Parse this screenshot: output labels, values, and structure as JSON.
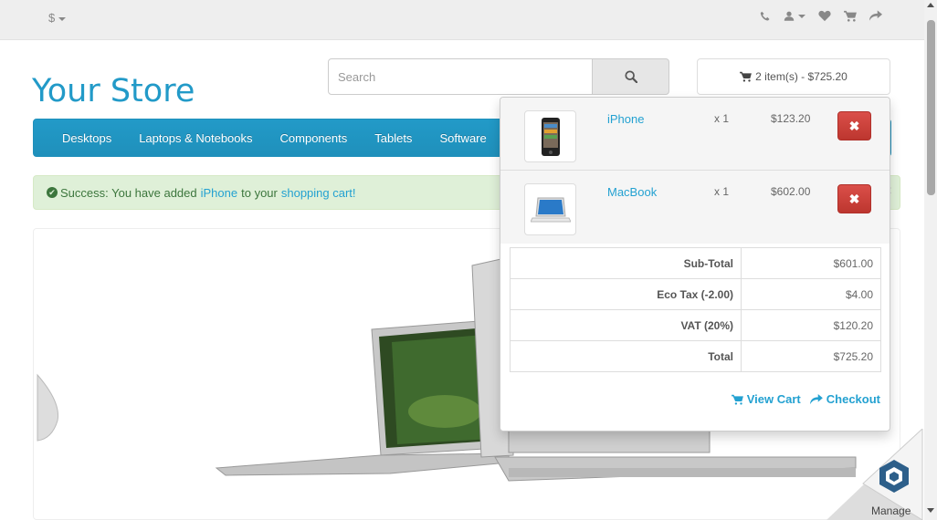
{
  "topbar": {
    "currency_symbol": "$",
    "icons": [
      "phone-icon",
      "user-icon",
      "heart-icon",
      "cart-icon",
      "share-icon"
    ]
  },
  "logo": {
    "text": "Your Store",
    "color": "#229ac8"
  },
  "search": {
    "placeholder": "Search"
  },
  "cart_button": {
    "label": "2 item(s) - $725.20"
  },
  "menu": {
    "items": [
      "Desktops",
      "Laptops & Notebooks",
      "Components",
      "Tablets",
      "Software"
    ]
  },
  "alert": {
    "prefix": "Success: You have added",
    "product_link": "iPhone",
    "middle": "to your",
    "cart_link": "shopping cart!",
    "close": "×"
  },
  "cart_dropdown": {
    "items": [
      {
        "name": "iPhone",
        "qty": "x 1",
        "price": "$123.20",
        "remove": "✖"
      },
      {
        "name": "MacBook",
        "qty": "x 1",
        "price": "$602.00",
        "remove": "✖"
      }
    ],
    "totals": [
      {
        "label": "Sub-Total",
        "value": "$601.00"
      },
      {
        "label": "Eco Tax (-2.00)",
        "value": "$4.00"
      },
      {
        "label": "VAT (20%)",
        "value": "$120.20"
      },
      {
        "label": "Total",
        "value": "$725.20"
      }
    ],
    "view_cart": "View Cart",
    "checkout": "Checkout"
  },
  "manage_badge": {
    "label": "Manage"
  },
  "colors": {
    "accent": "#229ac8",
    "link": "#23a1d1",
    "danger": "#da4f49",
    "success_bg": "#dff0d8"
  }
}
